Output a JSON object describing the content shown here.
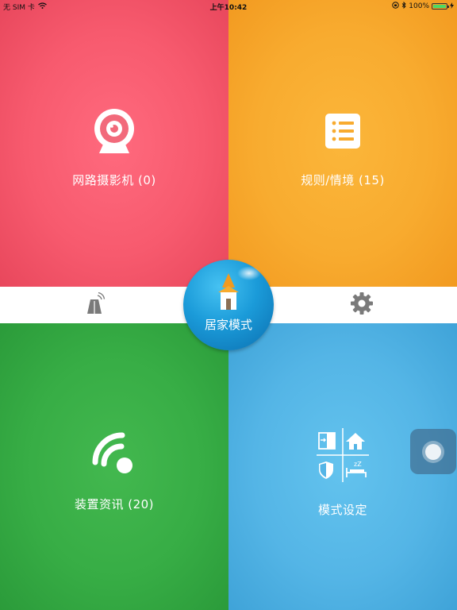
{
  "status_bar": {
    "carrier": "无 SIM 卡",
    "time": "上午10:42",
    "battery": "100%",
    "wifi_icon": "wifi-icon",
    "bluetooth_icon": "bluetooth-icon",
    "lock_icon": "rotation-lock-icon"
  },
  "tiles": {
    "camera": {
      "label": "网路摄影机 (0)",
      "icon": "webcam-icon",
      "color": "#f75a6e"
    },
    "rules": {
      "label": "规则/情境 (15)",
      "icon": "list-icon",
      "color": "#f8ab2f"
    },
    "devices": {
      "label": "装置资讯 (20)",
      "icon": "wireless-signal-icon",
      "color": "#37ad45"
    },
    "mode": {
      "label": "模式设定",
      "icon": "mode-grid-icon",
      "color": "#54b5e6"
    }
  },
  "middle_bar": {
    "left_icon": "gateway-icon",
    "right_icon": "gear-icon"
  },
  "center": {
    "label": "居家模式",
    "icon": "home-icon",
    "color": "#1b9bd9"
  },
  "assistive_touch": {
    "icon": "assistive-touch-icon"
  }
}
